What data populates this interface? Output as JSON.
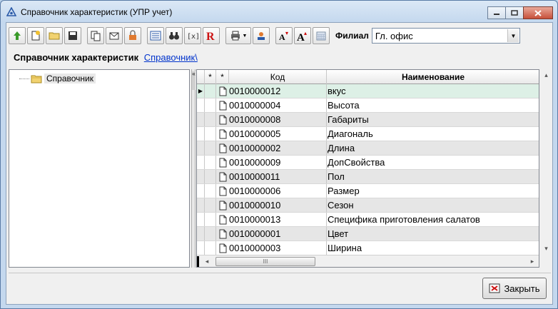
{
  "window": {
    "title": "Справочник характеристик (УПР учет)"
  },
  "toolbar": {
    "filial_label": "Филиал",
    "filial_value": "Гл. офис"
  },
  "header": {
    "title": "Справочник характеристик",
    "link": "Справочник\\"
  },
  "tree": {
    "root_label": "Справочник"
  },
  "grid": {
    "columns": {
      "star1": "*",
      "star2": "*",
      "code": "Код",
      "name": "Наименование"
    },
    "rows": [
      {
        "code": "0010000012",
        "name": "вкус"
      },
      {
        "code": "0010000004",
        "name": "Высота"
      },
      {
        "code": "0010000008",
        "name": "Габариты"
      },
      {
        "code": "0010000005",
        "name": "Диагональ"
      },
      {
        "code": "0010000002",
        "name": "Длина"
      },
      {
        "code": "0010000009",
        "name": "ДопСвойства"
      },
      {
        "code": "0010000011",
        "name": "Пол"
      },
      {
        "code": "0010000006",
        "name": "Размер"
      },
      {
        "code": "0010000010",
        "name": "Сезон"
      },
      {
        "code": "0010000013",
        "name": "Специфика приготовления салатов"
      },
      {
        "code": "0010000001",
        "name": "Цвет"
      },
      {
        "code": "0010000003",
        "name": "Ширина"
      }
    ],
    "scroll_thumb_grip": "III"
  },
  "footer": {
    "close_label": "Закрыть"
  },
  "colors": {
    "selected_row": "#ddf0e6",
    "alt_row": "#e6e6e6",
    "link": "#0033cc",
    "window_frame": "#c4d8ee"
  }
}
